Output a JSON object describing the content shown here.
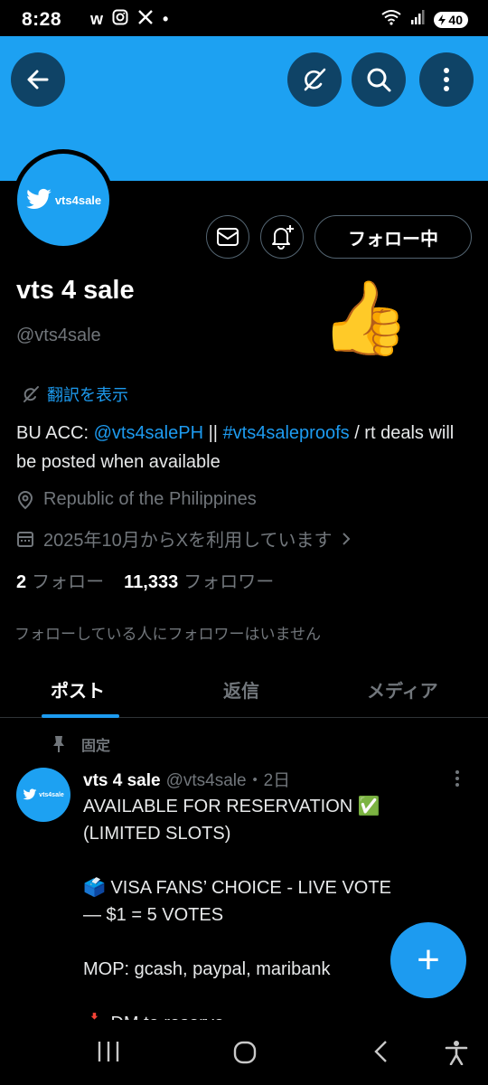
{
  "status_bar": {
    "time": "8:28",
    "app_icons": [
      "w",
      "instagram-icon",
      "x-logo-icon",
      "•"
    ],
    "battery": "40"
  },
  "profile": {
    "avatar_text": "vts4sale",
    "follow_button": "フォロー中",
    "name": "vts 4 sale",
    "handle": "@vts4sale",
    "emoji": "👍",
    "translate": "翻訳を表示",
    "bio": {
      "prefix": "BU ACC: ",
      "mention": "@vts4salePH",
      "sep": " || ",
      "hashtag": "#vts4saleproofs",
      "suffix": " / rt deals will be posted when available"
    },
    "location": "Republic of the Philippines",
    "joined": "2025年10月からXを利用しています",
    "following_count": "2",
    "following_label": "フォロー",
    "followers_count": "11,333",
    "followers_label": "フォロワー",
    "no_followers_note": "フォローしている人にフォロワーはいません"
  },
  "tabs": [
    {
      "label": "ポスト",
      "active": true
    },
    {
      "label": "返信",
      "active": false
    },
    {
      "label": "メディア",
      "active": false
    }
  ],
  "post": {
    "pinned_label": "固定",
    "avatar_text": "vts4sale",
    "name": "vts 4 sale",
    "handle": "@vts4sale",
    "time": "・2日",
    "body": "AVAILABLE FOR RESERVATION ✅\n(LIMITED SLOTS)\n\n🗳️ VISA FANS’ CHOICE - LIVE VOTE\n— $1 = 5 VOTES\n\nMOP: gcash, paypal, maribank\n\n📩 DM to reserve"
  },
  "fab": "+",
  "colors": {
    "banner": "#1da1f2",
    "accent": "#1d9bf0",
    "muted": "#71767b"
  }
}
